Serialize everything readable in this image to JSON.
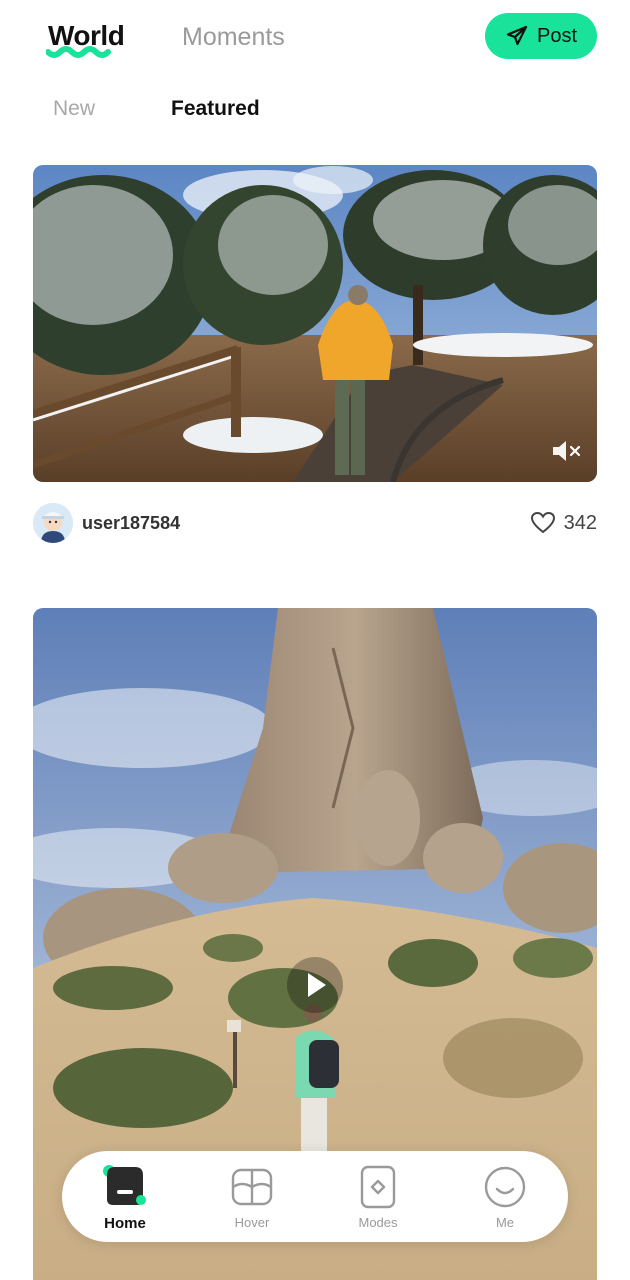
{
  "header": {
    "tabs": [
      {
        "label": "World",
        "active": true
      },
      {
        "label": "Moments",
        "active": false
      }
    ],
    "post_label": "Post"
  },
  "sub_tabs": [
    {
      "label": "New",
      "active": false
    },
    {
      "label": "Featured",
      "active": true
    }
  ],
  "feed": [
    {
      "image_desc_icon": "snowy-trail-photo",
      "username": "user187584",
      "likes": "342",
      "muted": true
    },
    {
      "image_desc_icon": "desert-rock-photo",
      "has_play": true
    }
  ],
  "bottom_nav": [
    {
      "label": "Home",
      "icon": "home-icon",
      "active": true
    },
    {
      "label": "Hover",
      "icon": "hover-icon",
      "active": false
    },
    {
      "label": "Modes",
      "icon": "modes-icon",
      "active": false
    },
    {
      "label": "Me",
      "icon": "me-icon",
      "active": false
    }
  ],
  "colors": {
    "accent": "#19e39a",
    "text_primary": "#111111",
    "text_muted": "#9a9a9a"
  }
}
